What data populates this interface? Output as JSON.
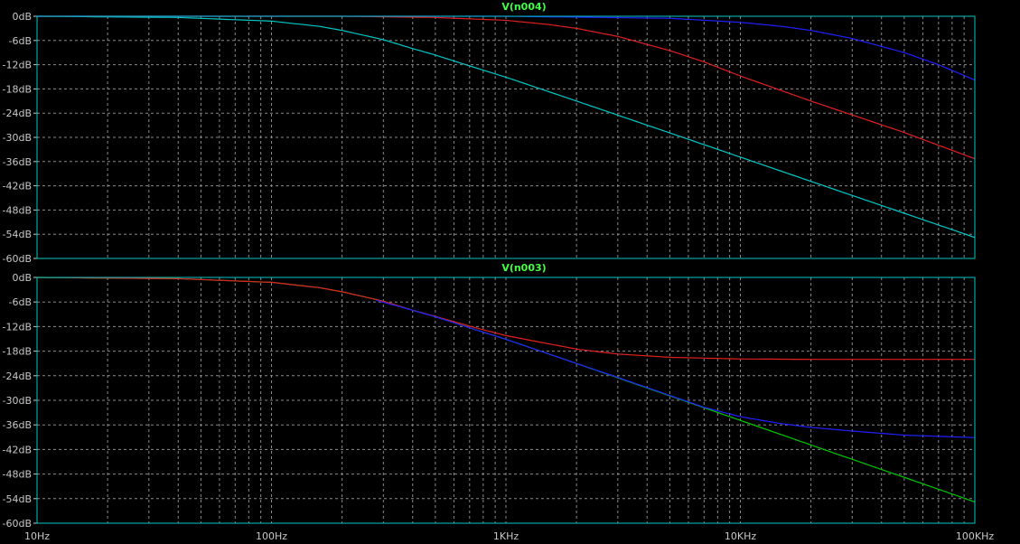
{
  "chart_data": [
    {
      "type": "line",
      "title": "V(n004)",
      "x_scale": "log",
      "xlim": [
        10,
        100000
      ],
      "ylim": [
        -60,
        0
      ],
      "yticks": [
        "0dB",
        "-6dB",
        "-12dB",
        "-18dB",
        "-24dB",
        "-30dB",
        "-36dB",
        "-42dB",
        "-48dB",
        "-54dB",
        "-60dB"
      ],
      "xticks": [],
      "grid": true,
      "series": [
        {
          "color": "#00c8c8",
          "x": [
            10,
            40,
            100,
            160,
            200,
            300,
            400,
            500,
            700,
            1000,
            2000,
            3000,
            5000,
            10000,
            20000,
            50000,
            100000
          ],
          "values": [
            0,
            -0.3,
            -1.2,
            -2.5,
            -3.5,
            -5.8,
            -8.0,
            -9.6,
            -12.3,
            -15.1,
            -21.0,
            -24.5,
            -28.9,
            -34.9,
            -40.9,
            -48.8,
            -54.8
          ]
        },
        {
          "color": "#e02020",
          "x": [
            10,
            200,
            500,
            1000,
            1500,
            2000,
            3000,
            5000,
            7000,
            10000,
            20000,
            50000,
            100000
          ],
          "values": [
            0,
            0,
            -0.3,
            -1.0,
            -2.0,
            -3.0,
            -5.0,
            -8.5,
            -11.3,
            -14.8,
            -21.0,
            -28.8,
            -35.3
          ]
        },
        {
          "color": "#2020ff",
          "x": [
            10,
            1000,
            5000,
            10000,
            15000,
            20000,
            30000,
            50000,
            70000,
            100000
          ],
          "values": [
            0,
            0,
            -0.5,
            -1.5,
            -2.5,
            -3.5,
            -5.5,
            -9.0,
            -12.0,
            -15.8
          ]
        }
      ]
    },
    {
      "type": "line",
      "title": "V(n003)",
      "x_scale": "log",
      "xlim": [
        10,
        100000
      ],
      "ylim": [
        -60,
        0
      ],
      "yticks": [
        "0dB",
        "-6dB",
        "-12dB",
        "-18dB",
        "-24dB",
        "-30dB",
        "-36dB",
        "-42dB",
        "-48dB",
        "-54dB",
        "-60dB"
      ],
      "xticks": [
        "10Hz",
        "100Hz",
        "1KHz",
        "10KHz",
        "100KHz"
      ],
      "grid": true,
      "series": [
        {
          "color": "#00c800",
          "x": [
            10,
            40,
            100,
            160,
            200,
            300,
            400,
            500,
            700,
            1000,
            2000,
            3000,
            5000,
            10000,
            20000,
            50000,
            100000
          ],
          "values": [
            0,
            -0.3,
            -1.2,
            -2.5,
            -3.5,
            -5.8,
            -8.0,
            -9.6,
            -12.3,
            -15.1,
            -21.0,
            -24.5,
            -28.9,
            -34.9,
            -40.9,
            -48.8,
            -54.8
          ]
        },
        {
          "color": "#e02020",
          "x": [
            10,
            40,
            100,
            160,
            200,
            300,
            400,
            500,
            700,
            1000,
            2000,
            3000,
            5000,
            10000,
            20000,
            50000,
            100000
          ],
          "values": [
            0,
            -0.3,
            -1.2,
            -2.5,
            -3.5,
            -5.8,
            -8.0,
            -9.5,
            -11.9,
            -14.2,
            -17.5,
            -18.7,
            -19.5,
            -19.9,
            -20.0,
            -20.0,
            -20.0
          ]
        },
        {
          "color": "#2020ff",
          "x": [
            280,
            400,
            500,
            700,
            1000,
            2000,
            3000,
            5000,
            7000,
            10000,
            15000,
            20000,
            30000,
            50000,
            100000
          ],
          "values": [
            -5.6,
            -8.0,
            -9.6,
            -12.3,
            -15.1,
            -21.0,
            -24.4,
            -28.8,
            -31.7,
            -34.0,
            -35.7,
            -36.6,
            -37.5,
            -38.5,
            -39.1
          ]
        }
      ]
    }
  ],
  "colors": {
    "background": "#000000",
    "grid": "#8a8a8a",
    "frame": "#00c8c8",
    "axis_text": "#c8c8c8",
    "title_text": "#40ff40"
  }
}
